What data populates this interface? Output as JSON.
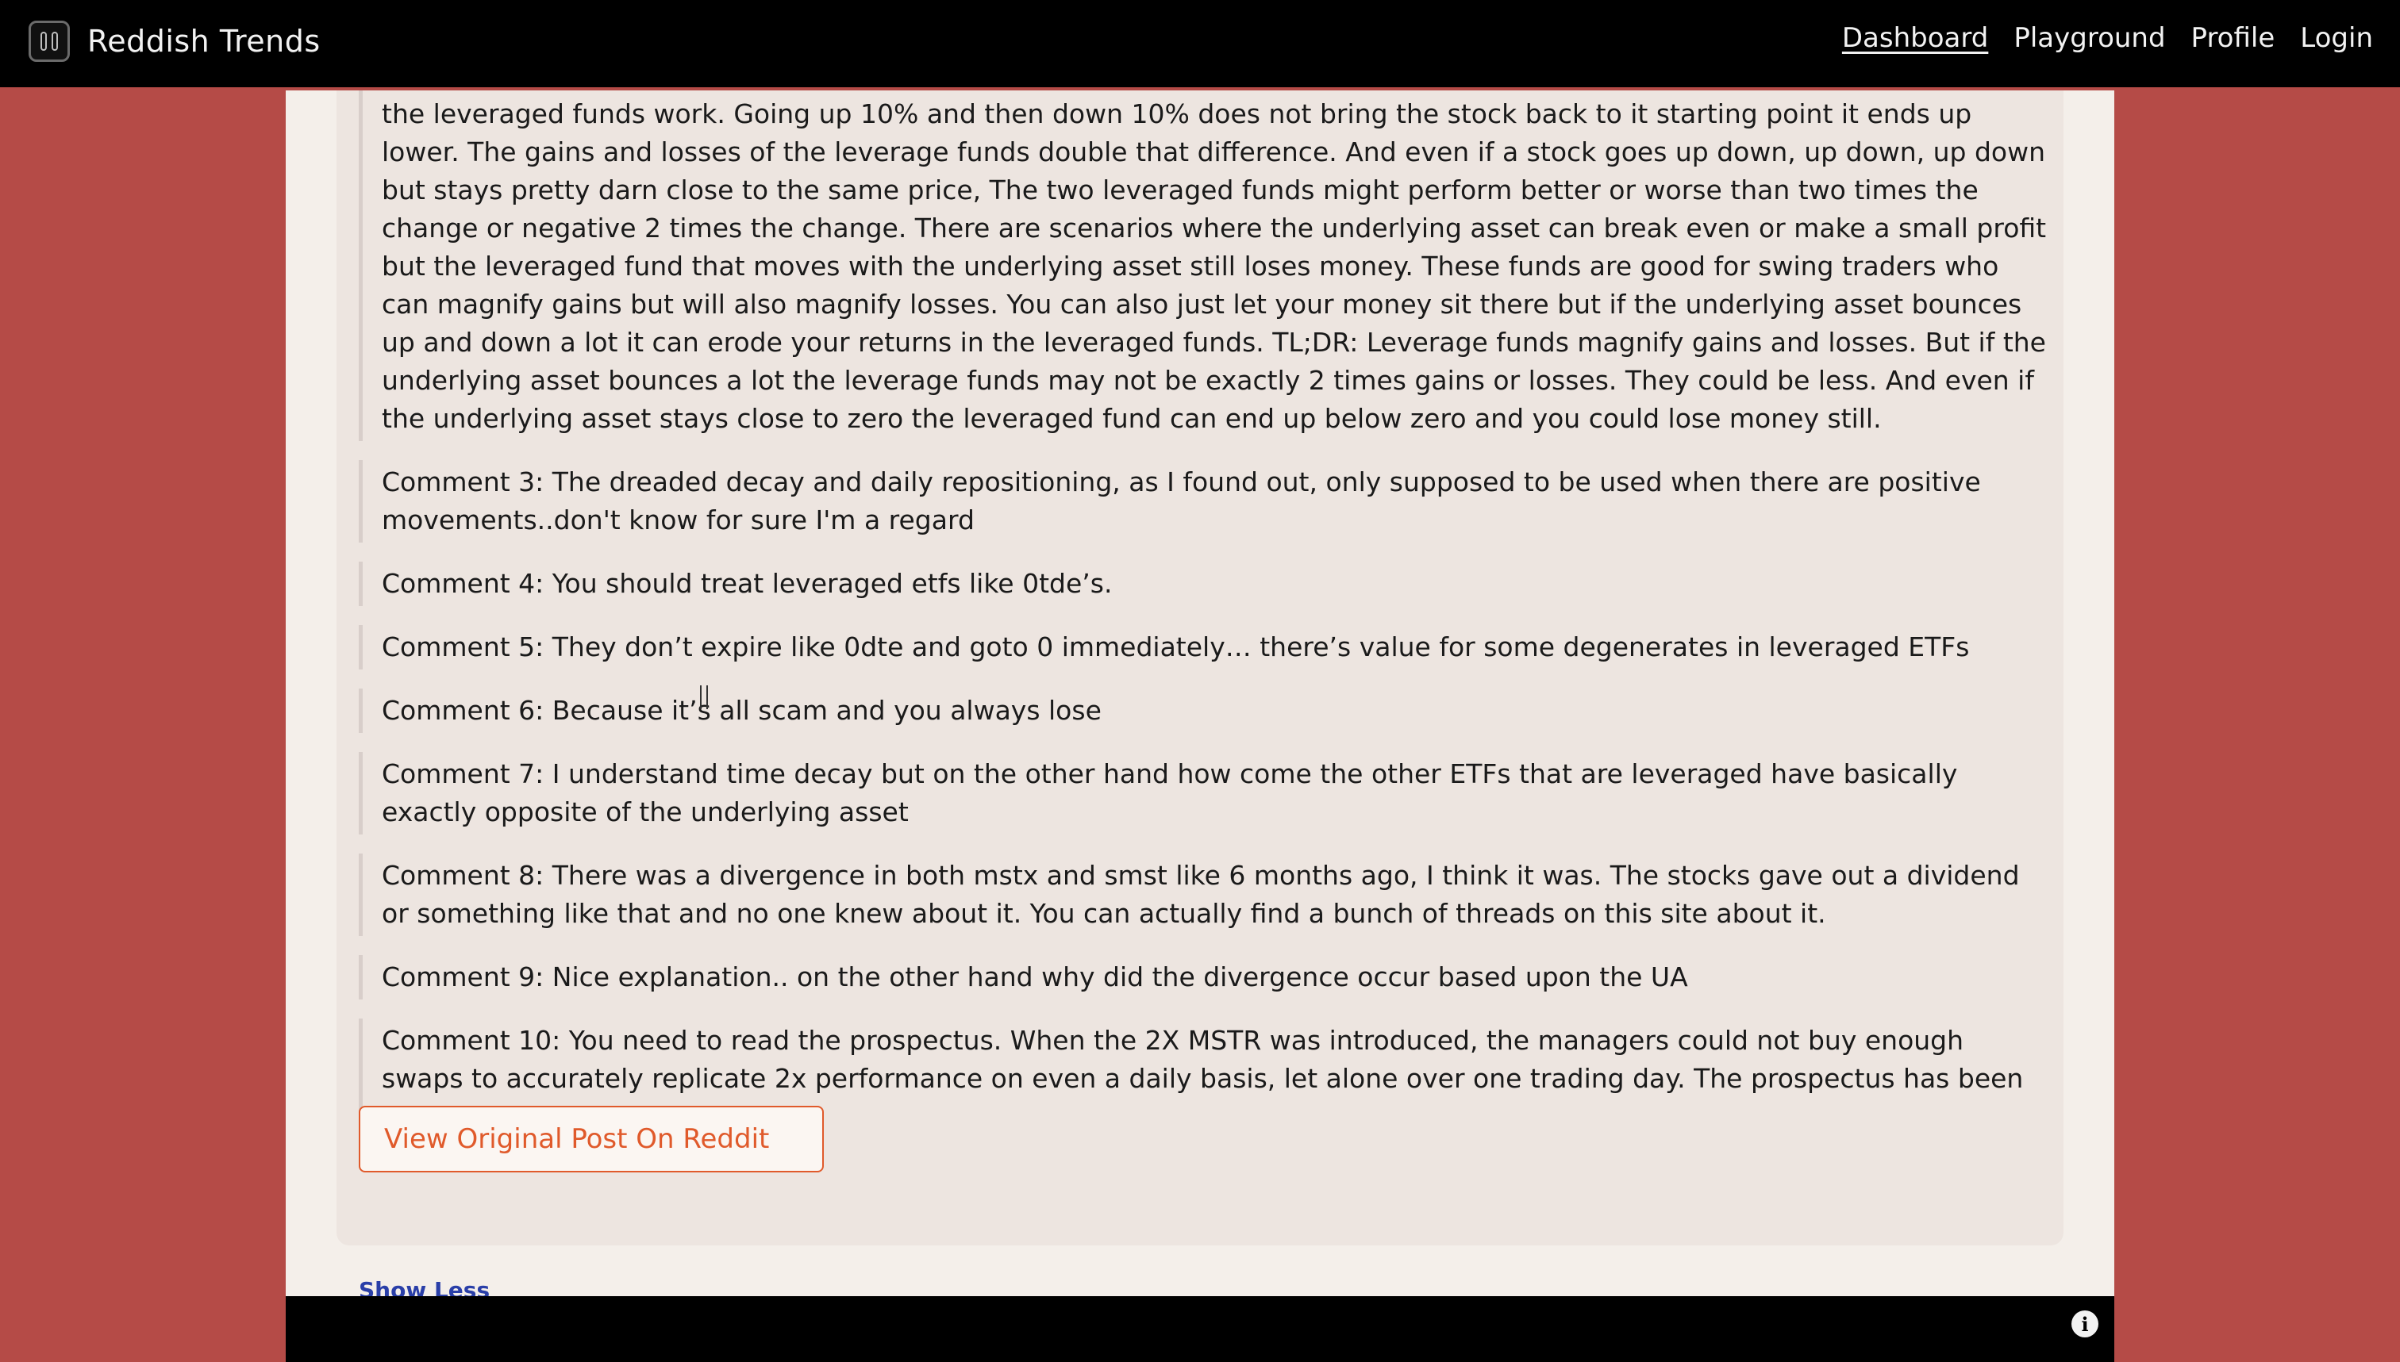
{
  "header": {
    "brand": "Reddish Trends",
    "nav": [
      {
        "label": "Dashboard"
      },
      {
        "label": "Playground"
      },
      {
        "label": "Profile"
      },
      {
        "label": "Login"
      }
    ]
  },
  "comments": [
    "the leveraged funds work. Going up 10% and then down 10% does not bring the stock back to it starting point it ends up lower. The gains and losses of the leverage funds double that difference. And even if a stock goes up down, up down, up down but stays pretty darn close to the same price, The two leveraged funds might perform better or worse than two times the change or negative 2 times the change. There are scenarios where the underlying asset can break even or make a small profit but the leveraged fund that moves with the underlying asset still loses money. These funds are good for swing traders who can magnify gains but will also magnify losses. You can also just let your money sit there but if the underlying asset bounces up and down a lot it can erode your returns in the leveraged funds. TL;DR: Leverage funds magnify gains and losses. But if the underlying asset bounces a lot the leverage funds may not be exactly 2 times gains or losses. They could be less. And even if the underlying asset stays close to zero the leveraged fund can end up below zero and you could lose money still.",
    "Comment 3: The dreaded decay and daily repositioning, as I found out, only supposed to be used when there are positive movements..don't know for sure I'm a regard",
    "Comment 4: You should treat leveraged etfs like 0tde’s.",
    "Comment 5: They don’t expire like 0dte and goto 0 immediately… there’s value for some degenerates in leveraged ETFs",
    "Comment 6: Because it’s all scam and you always lose",
    "Comment 7: I understand time decay but on the other hand how come the other ETFs that are leveraged have basically exactly opposite of the underlying asset",
    "Comment 8: There was a divergence in both mstx and smst like 6 months ago, I think it was. The stocks gave out a dividend or something like that and no one knew about it. You can actually find a bunch of threads on this site about it.",
    "Comment 9: Nice explanation.. on the other hand why did the divergence occur based upon the UA",
    "Comment 10: You need to read the prospectus. When the 2X MSTR was introduced, the managers could not buy enough swaps to accurately replicate 2x performance on even a daily basis, let alone over one trading day. The prospectus has been updated to highlight this risk."
  ],
  "actions": {
    "view_original": "View Original Post On Reddit",
    "show_less": "Show Less"
  },
  "footer": {
    "info_icon": "info-icon"
  },
  "colors": {
    "background": "#b54b47",
    "navbar": "#000000",
    "accent": "#e05a2b",
    "link": "#2a3fa8"
  }
}
